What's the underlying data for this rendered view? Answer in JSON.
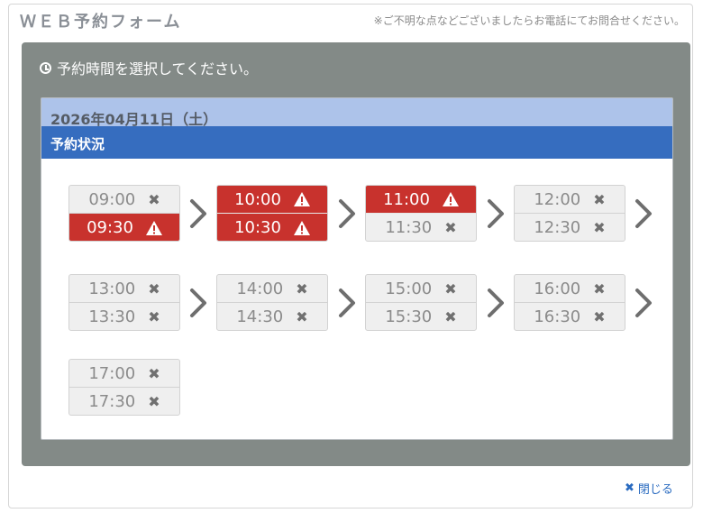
{
  "header": {
    "title": "ＷＥＢ予約フォーム",
    "notice": "※ご不明な点などございましたらお電話にてお問合せください。"
  },
  "panel": {
    "title": "予約時間を選択してください。",
    "date": "2026年04月11日（土）",
    "status_label": "予約状況"
  },
  "slots": [
    {
      "top": {
        "time": "09:00",
        "state": "unavailable"
      },
      "bottom": {
        "time": "09:30",
        "state": "few"
      }
    },
    {
      "top": {
        "time": "10:00",
        "state": "few"
      },
      "bottom": {
        "time": "10:30",
        "state": "few"
      }
    },
    {
      "top": {
        "time": "11:00",
        "state": "few"
      },
      "bottom": {
        "time": "11:30",
        "state": "unavailable"
      }
    },
    {
      "top": {
        "time": "12:00",
        "state": "unavailable"
      },
      "bottom": {
        "time": "12:30",
        "state": "unavailable"
      }
    },
    {
      "top": {
        "time": "13:00",
        "state": "unavailable"
      },
      "bottom": {
        "time": "13:30",
        "state": "unavailable"
      }
    },
    {
      "top": {
        "time": "14:00",
        "state": "unavailable"
      },
      "bottom": {
        "time": "14:30",
        "state": "unavailable"
      }
    },
    {
      "top": {
        "time": "15:00",
        "state": "unavailable"
      },
      "bottom": {
        "time": "15:30",
        "state": "unavailable"
      }
    },
    {
      "top": {
        "time": "16:00",
        "state": "unavailable"
      },
      "bottom": {
        "time": "16:30",
        "state": "unavailable"
      }
    },
    {
      "top": {
        "time": "17:00",
        "state": "unavailable"
      },
      "bottom": {
        "time": "17:30",
        "state": "unavailable"
      }
    }
  ],
  "icons": {
    "unavailable": "close-icon",
    "few": "warning-icon",
    "next": "chevron-right-icon"
  },
  "colors": {
    "full_red": "#c8322d",
    "date_bar": "#adc3ea",
    "status_bar": "#366dbf",
    "panel_bg": "#838a87",
    "link_blue": "#2a6bc0"
  },
  "footer": {
    "close_label": "閉じる"
  }
}
